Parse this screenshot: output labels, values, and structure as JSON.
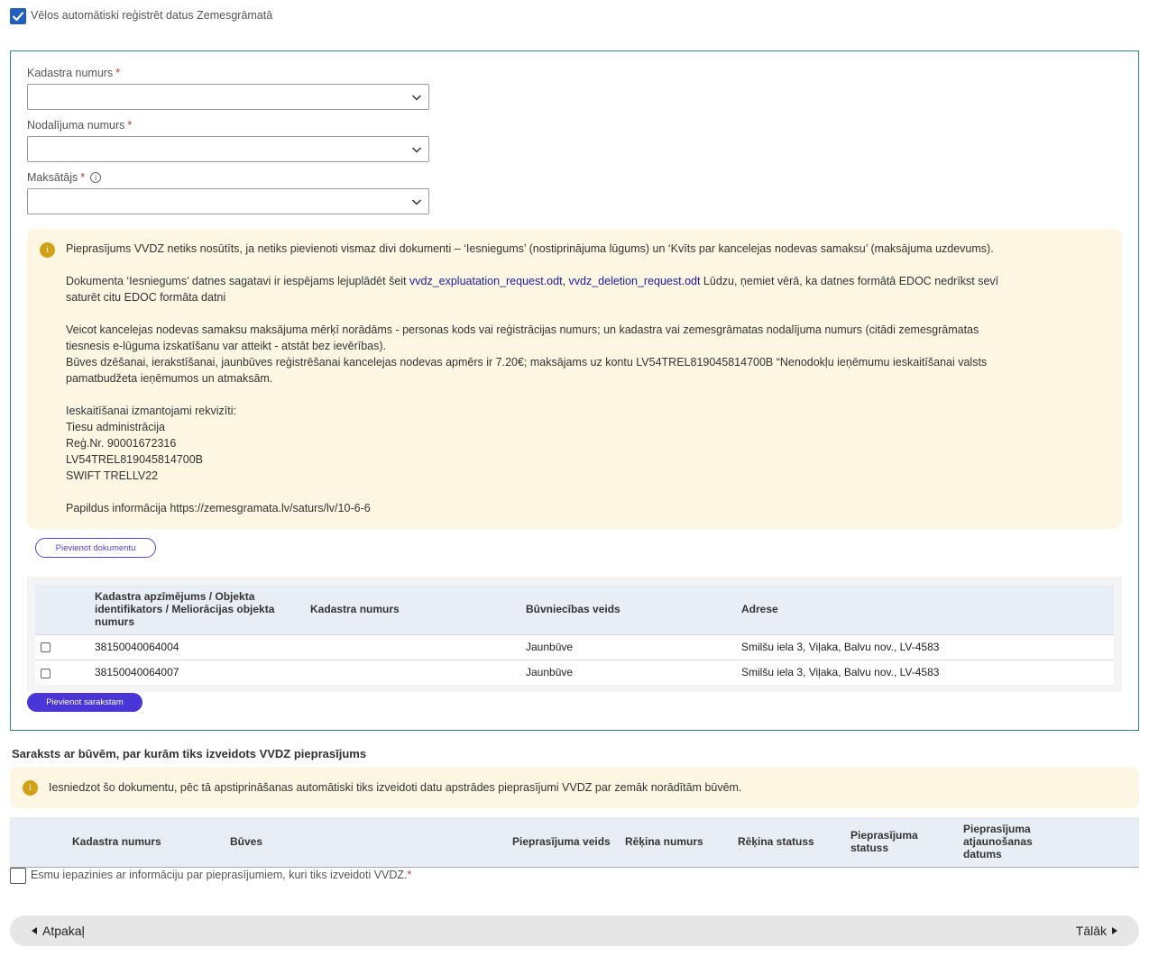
{
  "auto_register": {
    "checked": true,
    "label": "Vēlos automātiski reģistrēt datus Zemesgrāmatā"
  },
  "form": {
    "cadastre_number": {
      "label": "Kadastra numurs",
      "required_mark": "*",
      "value": ""
    },
    "division_number": {
      "label": "Nodalījuma numurs",
      "required_mark": "*",
      "value": ""
    },
    "payer": {
      "label": "Maksātājs",
      "required_mark": "*",
      "info_icon": "i",
      "value": ""
    }
  },
  "notice": {
    "icon": "i",
    "p1": "Pieprasījums VVDZ netiks nosūtīts, ja netiks pievienoti vismaz divi dokumenti – ‘Iesniegums’ (nostiprinājuma lūgums) un ‘Kvīts par kancelejas nodevas samaksu’ (maksājuma uzdevums).",
    "p2_before": "Dokumenta ‘Iesniegums’ datnes sagatavi ir iespējams lejuplādēt šeit ",
    "link1": "vvdz_expluatation_request.odt",
    "sep": ", ",
    "link2": "vvdz_deletion_request.odt",
    "p2_after": " Lūdzu, ņemiet vērā, ka datnes formātā EDOC nedrīkst sevī saturēt citu EDOC formāta datni",
    "p3": "Veicot kancelejas nodevas samaksu maksājuma mērķī norādāms - personas kods vai reģistrācijas numurs; un kadastra vai zemesgrāmatas nodalījuma numurs (citādi zemesgrāmatas tiesnesis e-lūguma izskatīšanu var atteikt - atstāt bez ievērības).",
    "p4": "Būves dzēšanai, ierakstīšanai, jaunbūves reģistrēšanai kancelejas nodevas apmērs ir 7.20€; maksājams uz kontu LV54TREL819045814700B “Nenodokļu ieņēmumu ieskaitīšanai valsts pamatbudžeta ieņēmumos un atmaksām.",
    "p5": "Ieskaitīšanai izmantojami rekvizīti:",
    "p6": "Tiesu administrācija",
    "p7": "Reģ.Nr. 90001672316",
    "p8": "LV54TREL819045814700B",
    "p9": "SWIFT TRELLV22",
    "p10": "Papildus informācija https://zemesgramata.lv/saturs/lv/10-6-6"
  },
  "add_document_button": "Pievienot dokumentu",
  "buildings_table": {
    "headers": {
      "col1": "Kadastra apzīmējums / Objekta identifikators / Meliorācijas objekta numurs",
      "col2": "Kadastra numurs",
      "col3": "Būvniecības veids",
      "col4": "Adrese"
    },
    "rows": [
      {
        "checked": false,
        "designation": "38150040064004",
        "cadastre_number": "",
        "type": "Jaunbūve",
        "address": "Smilšu iela 3, Viļaka, Balvu nov., LV-4583"
      },
      {
        "checked": false,
        "designation": "38150040064007",
        "cadastre_number": "",
        "type": "Jaunbūve",
        "address": "Smilšu iela 3, Viļaka, Balvu nov., LV-4583"
      }
    ]
  },
  "add_to_list_button": "Pievienot sarakstam",
  "list_section": {
    "title": "Saraksts ar būvēm, par kurām tiks izveidots VVDZ pieprasījums",
    "notice_icon": "i",
    "notice_text": "Iesniedzot šo dokumentu, pēc tā apstiprināšanas automātiski tiks izveidoti datu apstrādes pieprasījumi VVDZ par zemāk norādītām būvēm.",
    "headers": {
      "col1": "Kadastra numurs",
      "col2": "Būves",
      "col3": "Pieprasījuma veids",
      "col4": "Rēķina numurs",
      "col5": "Rēķina statuss",
      "col6": "Pieprasījuma statuss",
      "col7": "Pieprasījuma atjaunošanas datums"
    }
  },
  "acknowledge": {
    "checked": false,
    "label": "Esmu iepazinies ar informāciju par pieprasījumiem, kuri tiks izveidoti VVDZ.",
    "required_mark": "*"
  },
  "nav": {
    "back": "Atpakaļ",
    "next": "Tālāk"
  }
}
